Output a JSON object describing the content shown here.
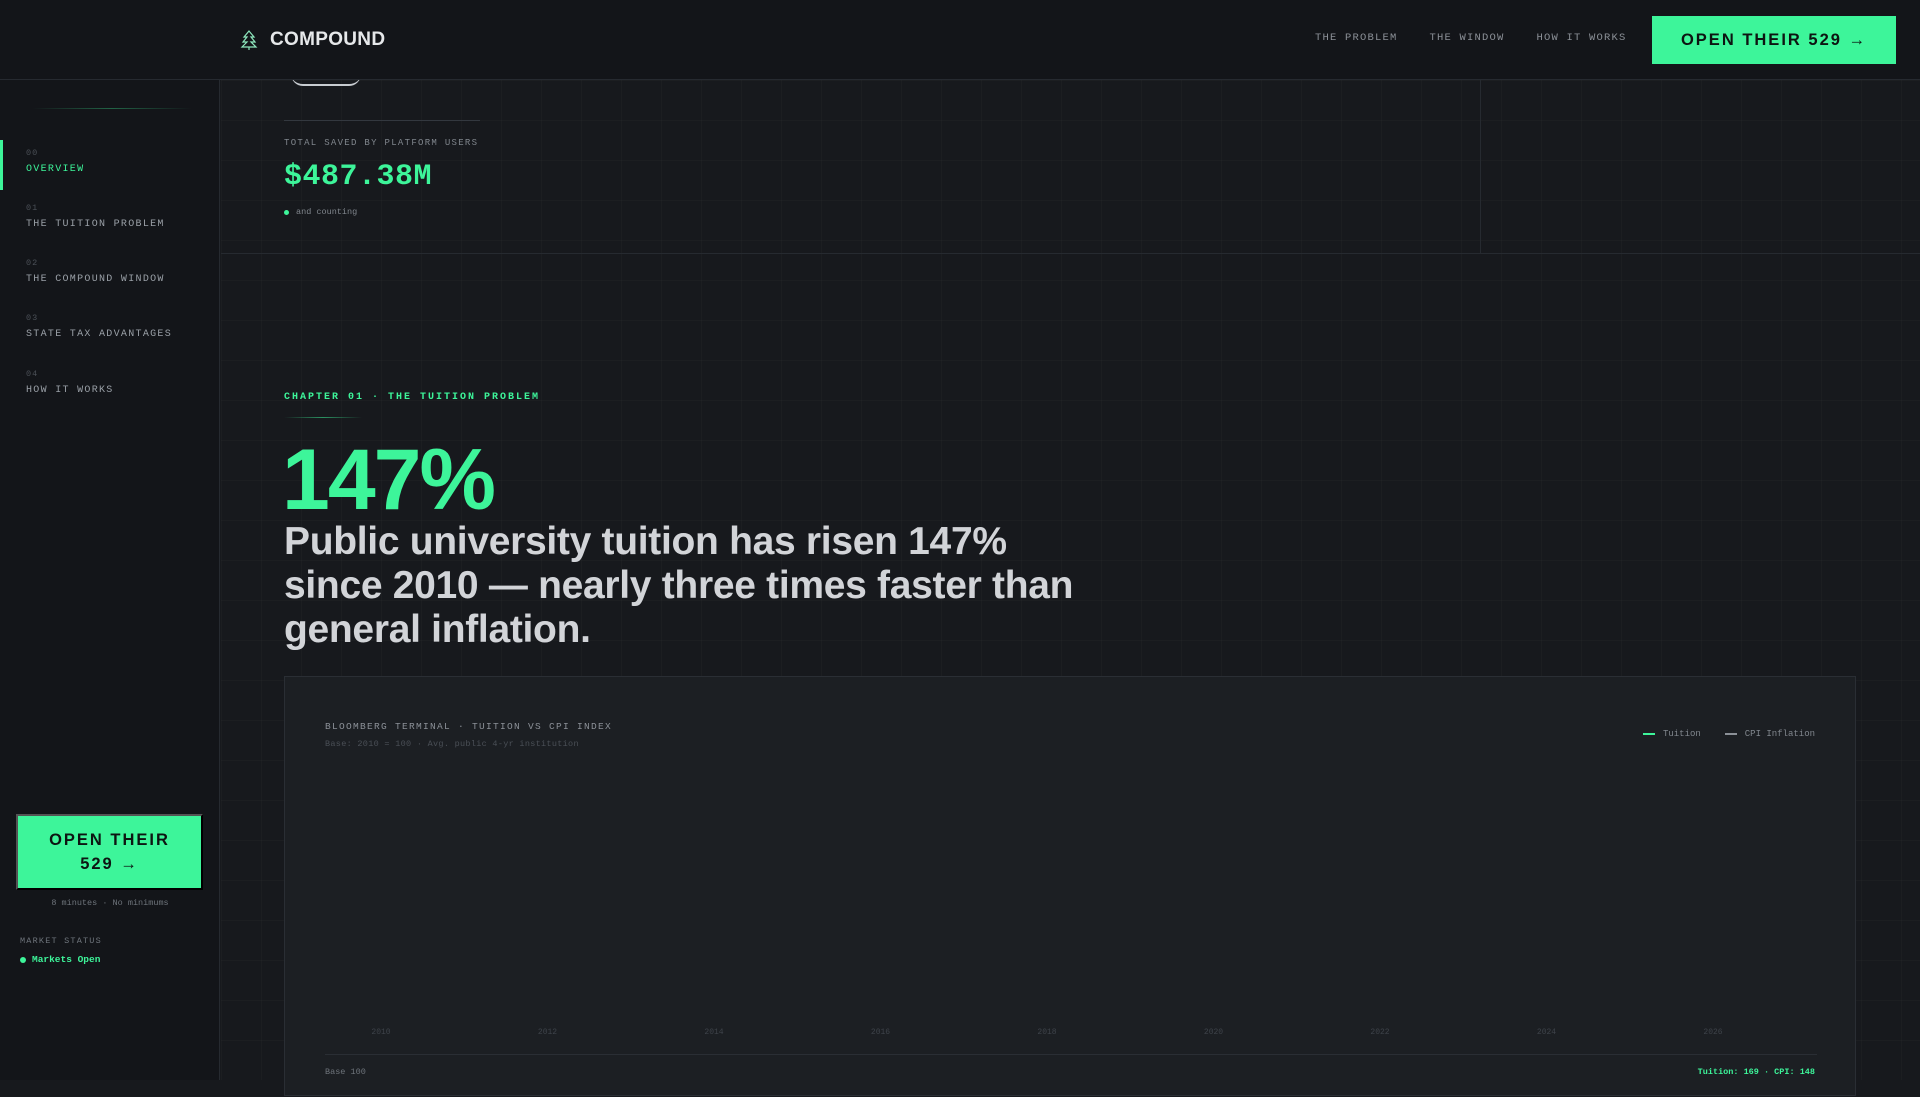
{
  "brand": {
    "name": "COMPOUND",
    "icon": "pine-tree-icon"
  },
  "topnav": {
    "items": [
      "THE PROBLEM",
      "THE WINDOW",
      "HOW IT WORKS"
    ],
    "cta": "OPEN THEIR 529 →"
  },
  "sidebar": {
    "items": [
      {
        "num": "00",
        "label": "OVERVIEW",
        "active": true
      },
      {
        "num": "01",
        "label": "THE TUITION PROBLEM",
        "active": false
      },
      {
        "num": "02",
        "label": "THE COMPOUND WINDOW",
        "active": false
      },
      {
        "num": "03",
        "label": "STATE TAX ADVANTAGES",
        "active": false
      },
      {
        "num": "04",
        "label": "HOW IT WORKS",
        "active": false
      }
    ],
    "cta": "OPEN THEIR 529 →",
    "note": "8 minutes · No minimums",
    "market_label": "MARKET STATUS",
    "market_status": "Markets Open"
  },
  "stats": {
    "label": "TOTAL SAVED BY PLATFORM USERS",
    "value": "$487.38M",
    "sub": "and counting"
  },
  "chapter": {
    "eyebrow": "CHAPTER 01 · THE TUITION PROBLEM",
    "big_stat": "147%",
    "headline": "Public university tuition has risen 147% since 2010 — nearly three times faster than general inflation."
  },
  "chart": {
    "title": "BLOOMBERG TERMINAL · TUITION VS CPI INDEX",
    "subtitle": "Base: 2010 = 100 · Avg. public 4-yr institution",
    "legend": [
      {
        "name": "Tuition",
        "color": "#3df59a"
      },
      {
        "name": "CPI Inflation",
        "color": "#8b9097"
      }
    ],
    "foot_left": "Base 100",
    "foot_right": "Tuition: 169 · CPI: 148"
  },
  "chart_data": {
    "type": "line",
    "title": "BLOOMBERG TERMINAL · TUITION VS CPI INDEX",
    "subtitle": "Base: 2010 = 100 · Avg. public 4-yr institution",
    "x": [
      "2010",
      "2012",
      "2014",
      "2016",
      "2018",
      "2020",
      "2022",
      "2024",
      "2026"
    ],
    "series": [
      {
        "name": "Tuition",
        "values": []
      },
      {
        "name": "CPI Inflation",
        "values": []
      }
    ],
    "legend": "top-right",
    "grid": false
  },
  "colors": {
    "accent": "#3df59a",
    "background": "#17191d",
    "panel": "#131519"
  }
}
